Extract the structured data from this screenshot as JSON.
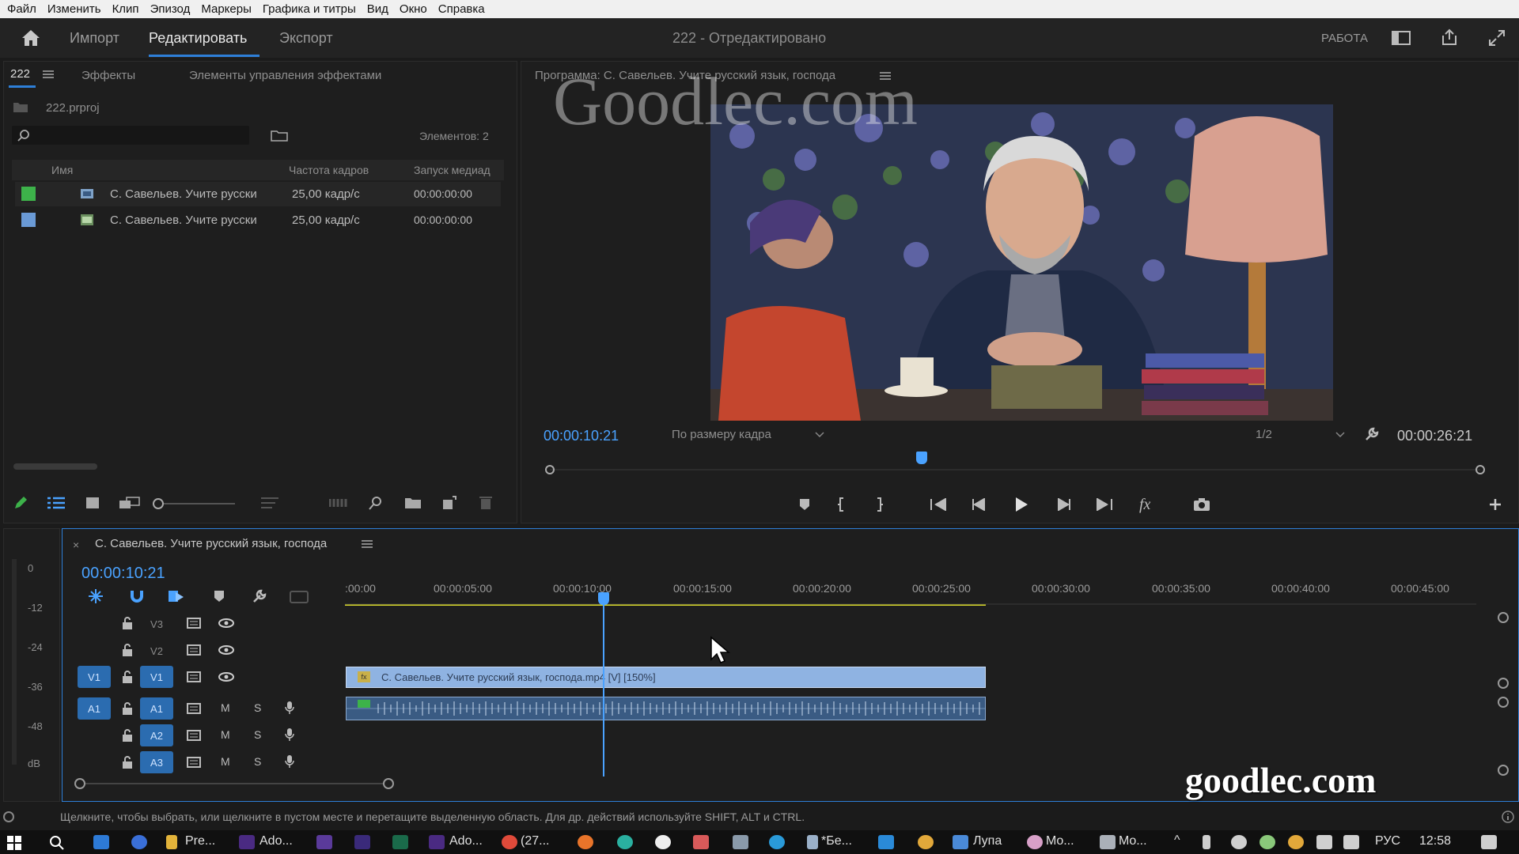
{
  "menu": [
    "Файл",
    "Изменить",
    "Клип",
    "Эпизод",
    "Маркеры",
    "Графика и титры",
    "Вид",
    "Окно",
    "Справка"
  ],
  "top_tabs": {
    "import": "Импорт",
    "edit": "Редактировать",
    "export": "Экспорт"
  },
  "doc_title": "222",
  "doc_status": "- Отредактировано",
  "workspace": "РАБОТА",
  "project_panel": {
    "tab": "222",
    "tab_effects": "Эффекты",
    "tab_effect_controls": "Элементы управления эффектами",
    "file": "222.prproj",
    "items_count": "Элементов: 2",
    "columns": {
      "name": "Имя",
      "fps": "Частота кадров",
      "start": "Запуск медиад"
    },
    "rows": [
      {
        "name": "С. Савельев. Учите русски",
        "fps": "25,00 кадр/с",
        "start": "00:00:00:00",
        "color": "#3db24a"
      },
      {
        "name": "С. Савельев. Учите русски",
        "fps": "25,00 кадр/с",
        "start": "00:00:00:00",
        "color": "#6a9ad6"
      }
    ]
  },
  "program_monitor": {
    "title": "Программа: С. Савельев. Учите русский язык, господа",
    "timecode": "00:00:10:21",
    "fit": "По размеру кадра",
    "resolution": "1/2",
    "duration": "00:00:26:21",
    "playhead_fraction": 0.4
  },
  "watermark_top": "Goodlec.com",
  "watermark_bottom": "goodlec.com",
  "timeline": {
    "tab": "С. Савельев. Учите русский язык, господа",
    "timecode": "00:00:10:21",
    "ruler": [
      ":00:00",
      "00:00:05:00",
      "00:00:10:00",
      "00:00:15:00",
      "00:00:20:00",
      "00:00:25:00",
      "00:00:30:00",
      "00:00:35:00",
      "00:00:40:00",
      "00:00:45:00"
    ],
    "tracks_video": [
      "V3",
      "V2",
      "V1"
    ],
    "tracks_audio": [
      "A1",
      "A2",
      "A3"
    ],
    "source_v": "V1",
    "source_a": "A1",
    "mute": "M",
    "solo": "S",
    "clip_video_label": "С. Савельев. Учите русский язык, господа.mp4 [V] [150%]",
    "meter_scale": [
      "0",
      "-12",
      "-24",
      "-36",
      "-48",
      "dB"
    ]
  },
  "status_bar": "Щелкните, чтобы выбрать, или щелкните в пустом месте и перетащите выделенную область. Для др. действий используйте SHIFT, ALT и CTRL.",
  "taskbar": {
    "items": [
      "Pre...",
      "Ado...",
      "Ado...",
      "(27...",
      "*Бе...",
      "Лупа",
      "Mo...",
      "Mo..."
    ],
    "lang": "РУС",
    "time": "12:58"
  }
}
